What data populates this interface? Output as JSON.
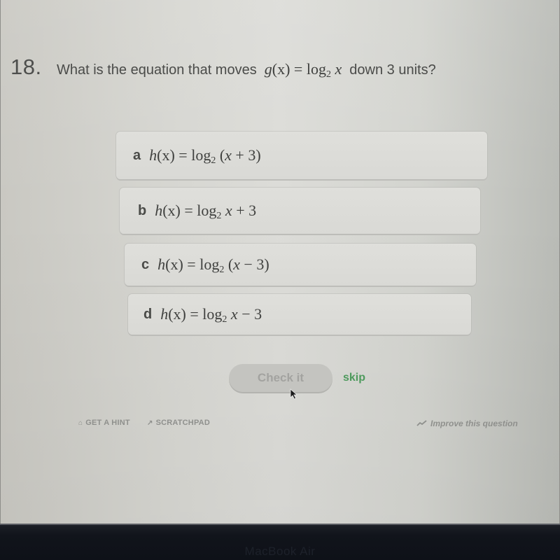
{
  "question": {
    "number": "18.",
    "text_prefix": "What is the equation that moves",
    "function_name": "g",
    "function_var": "(x) =",
    "log_base": "2",
    "log_arg": "x",
    "text_suffix": "down 3 units?"
  },
  "choices": [
    {
      "letter": "a",
      "lhs": "h",
      "lhs_var": "(x)",
      "eq": "=",
      "log": "log",
      "base": "2",
      "arg_open": "(",
      "arg_var": "x",
      "arg_rest": " + 3)",
      "tail": ""
    },
    {
      "letter": "b",
      "lhs": "h",
      "lhs_var": "(x)",
      "eq": "=",
      "log": "log",
      "base": "2",
      "arg_open": "",
      "arg_var": "x",
      "arg_rest": "",
      "tail": " + 3"
    },
    {
      "letter": "c",
      "lhs": "h",
      "lhs_var": "(x)",
      "eq": "=",
      "log": "log",
      "base": "2",
      "arg_open": "(",
      "arg_var": "x",
      "arg_rest": " − 3)",
      "tail": ""
    },
    {
      "letter": "d",
      "lhs": "h",
      "lhs_var": "(x)",
      "eq": "=",
      "log": "log",
      "base": "2",
      "arg_open": "",
      "arg_var": "x",
      "arg_rest": "",
      "tail": " − 3"
    }
  ],
  "actions": {
    "check_label": "Check it",
    "skip_label": "skip"
  },
  "footer": {
    "hint_icon": "hint-icon",
    "hint_label": "GET A HINT",
    "scratchpad_icon": "pencil-icon",
    "scratchpad_label": "SCRATCHPAD",
    "improve_icon": "trend-icon",
    "improve_label": "Improve this question"
  },
  "device": {
    "bezel_label": "MacBook Air"
  },
  "colors": {
    "skip": "#4e9a5d",
    "check_disabled_bg": "#c4c4c0",
    "bezel": "#11141b"
  }
}
